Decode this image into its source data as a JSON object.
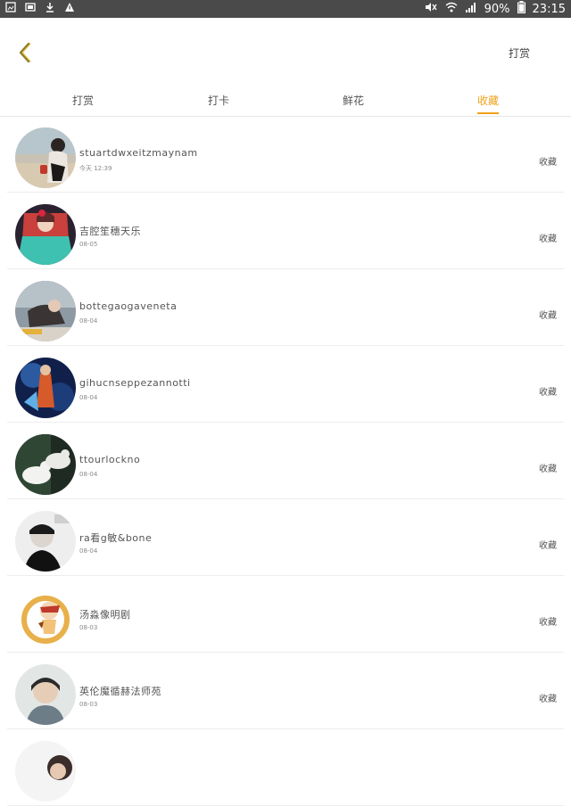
{
  "status_bar": {
    "battery": "90%",
    "time": "23:15"
  },
  "header": {
    "action_label": "打赏"
  },
  "tabs": [
    {
      "label": "打赏",
      "active": false
    },
    {
      "label": "打卡",
      "active": false
    },
    {
      "label": "鲜花",
      "active": false
    },
    {
      "label": "收藏",
      "active": true
    }
  ],
  "list": {
    "items": [
      {
        "name": "stuartdwxeitzmaynam",
        "time": "今天 12:39",
        "action": "收藏"
      },
      {
        "name": "吉腔笙穗天乐",
        "time": "08-05",
        "action": "收藏"
      },
      {
        "name": "bottegaogaveneta",
        "time": "08-04",
        "action": "收藏"
      },
      {
        "name": "gihucnseppezannotti",
        "time": "08-04",
        "action": "收藏"
      },
      {
        "name": "ttourlockno",
        "time": "08-04",
        "action": "收藏"
      },
      {
        "name": "ra看g敏&bone",
        "time": "08-04",
        "action": "收藏"
      },
      {
        "name": "汤淼像明剧",
        "time": "08-03",
        "action": "收藏"
      },
      {
        "name": "英伦魔循赫法师苑",
        "time": "08-03",
        "action": "收藏"
      }
    ]
  },
  "colors": {
    "accent": "#f0a11a",
    "status_bar": "#4a4a4a"
  }
}
